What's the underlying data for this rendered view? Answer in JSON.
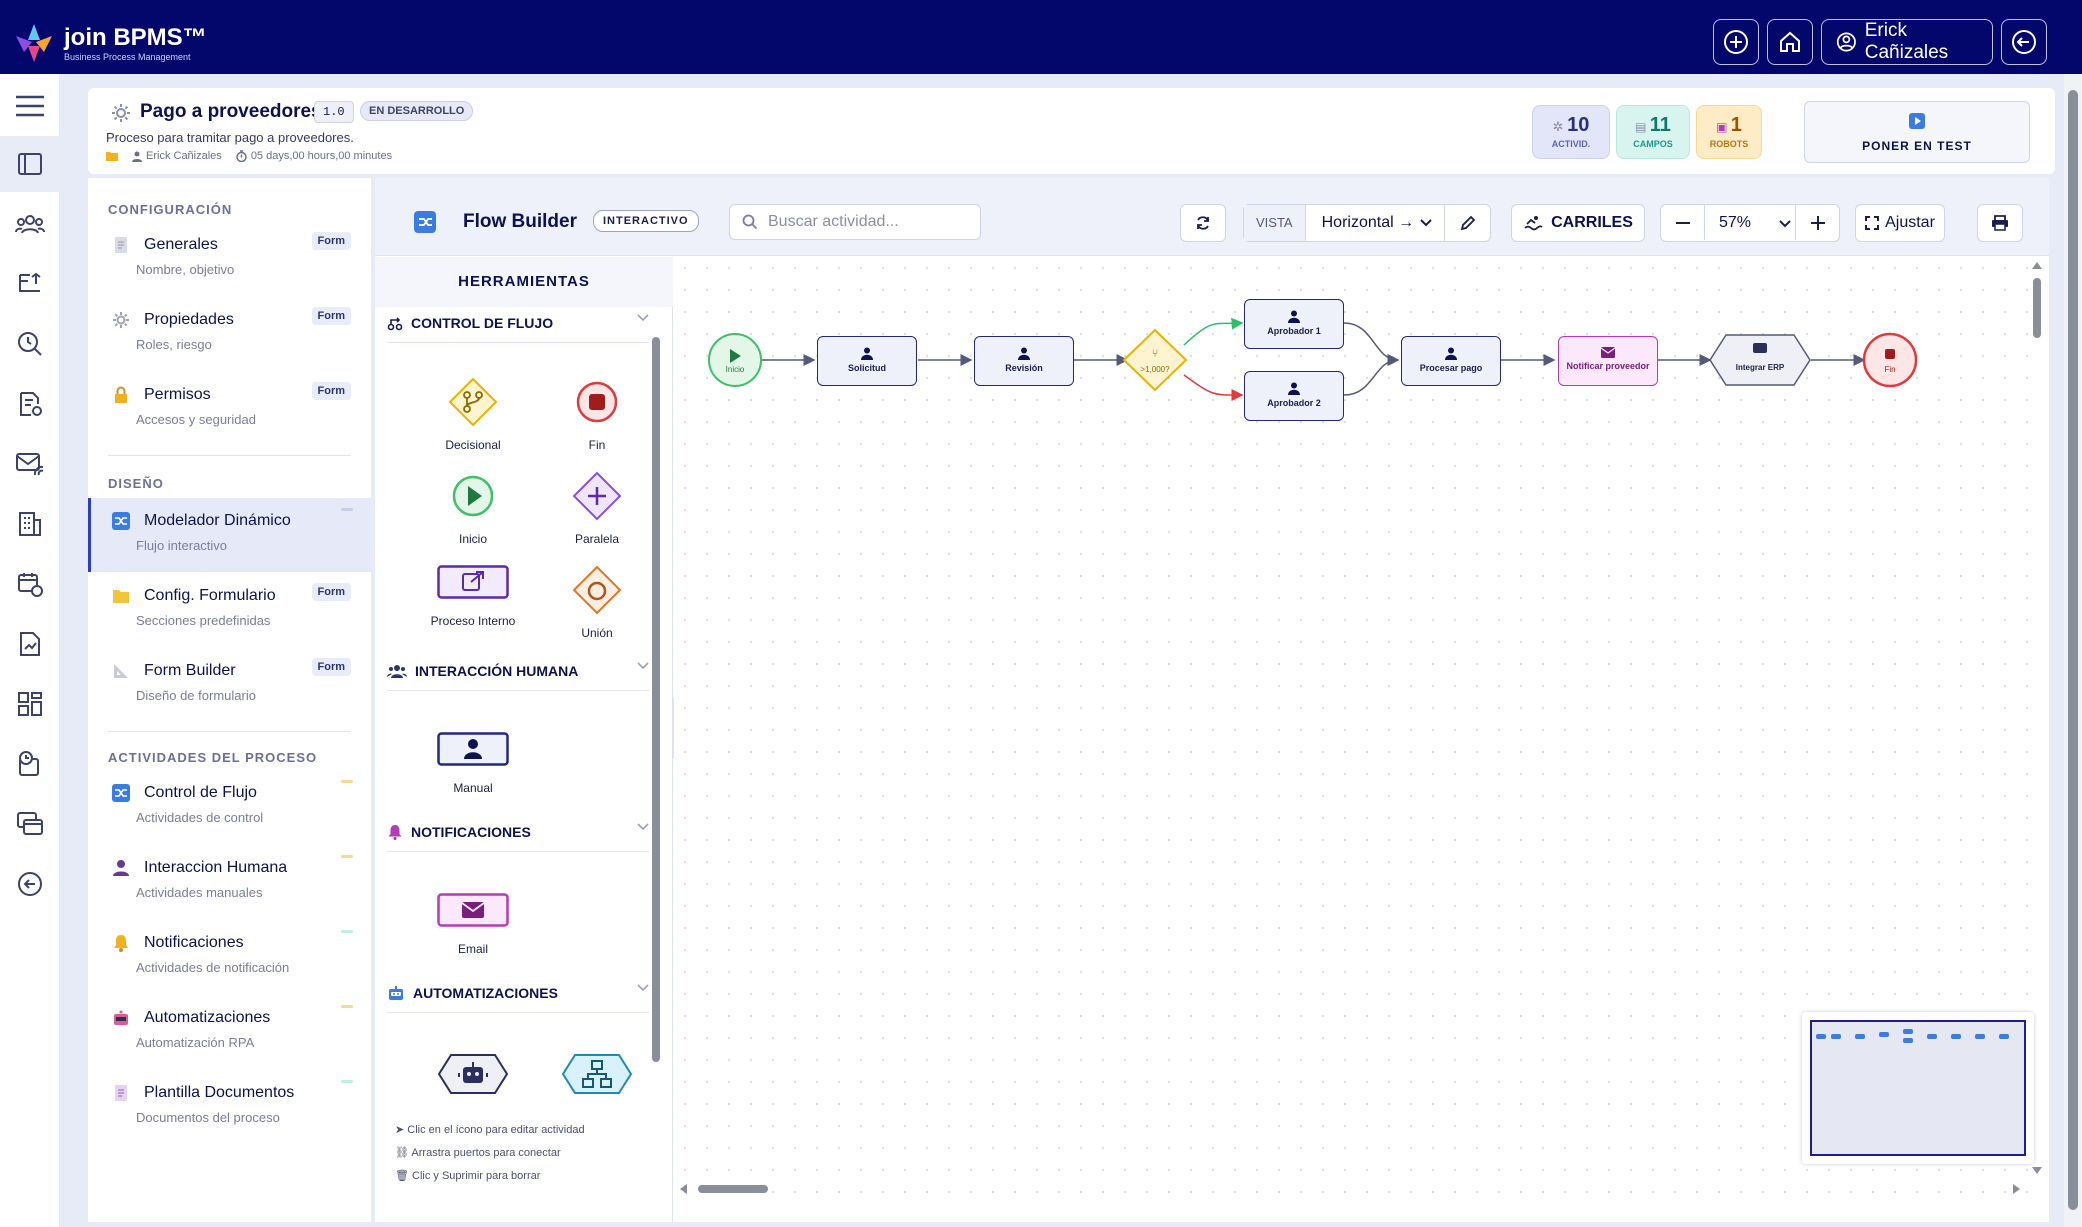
{
  "topbar": {
    "brand": "join BPMS™",
    "brand_sub": "Business Process Management",
    "user_name": "Erick Cañizales",
    "icons": [
      "plus-icon",
      "home-icon",
      "user-circle-icon",
      "logout-icon"
    ]
  },
  "rail": {
    "icons": [
      "menu-icon",
      "panels-icon",
      "users-icon",
      "flow-list-icon",
      "search-clock-icon",
      "doc-settings-icon",
      "mail-chart-icon",
      "building-icon",
      "calendar-check-icon",
      "file-chart-icon",
      "dashboard-icon",
      "calendar-clock-icon",
      "layers-icon",
      "back-circle-icon"
    ]
  },
  "process": {
    "title": "Pago a proveedores",
    "version": "1.0",
    "status": "EN DESARROLLO",
    "description": "Proceso para tramitar pago a proveedores.",
    "owner": "Erick Cañizales",
    "duration": "05 days,00 hours,00 minutes",
    "stats": [
      {
        "value": "10",
        "label": "ACTIVID.",
        "color": "#26307e",
        "bg": "#e3e6f8"
      },
      {
        "value": "11",
        "label": "CAMPOS",
        "color": "#0f7a6a",
        "bg": "#d8f4ef"
      },
      {
        "value": "1",
        "label": "ROBOTS",
        "color": "#9c5300",
        "bg": "#fdecc6"
      }
    ],
    "test_button": "PONER EN TEST"
  },
  "config": {
    "sections": [
      {
        "title": "CONFIGURACIÓN",
        "items": [
          {
            "title": "Generales",
            "sub": "Nombre, objetivo",
            "badge": "Form"
          },
          {
            "title": "Propiedades",
            "sub": "Roles, riesgo",
            "badge": "Form"
          },
          {
            "title": "Permisos",
            "sub": "Accesos y seguridad",
            "badge": "Form"
          }
        ]
      },
      {
        "title": "DISEÑO",
        "items": [
          {
            "title": "Modelador Dinámico",
            "sub": "Flujo interactivo",
            "badge": ""
          },
          {
            "title": "Config. Formulario",
            "sub": "Secciones predefinidas",
            "badge": "Form"
          },
          {
            "title": "Form Builder",
            "sub": "Diseño de formulario",
            "badge": "Form"
          }
        ]
      },
      {
        "title": "ACTIVIDADES DEL PROCESO",
        "items": [
          {
            "title": "Control de Flujo",
            "sub": "Actividades de control",
            "badge": ""
          },
          {
            "title": "Interaccion Humana",
            "sub": "Actividades manuales",
            "badge": ""
          },
          {
            "title": "Notificaciones",
            "sub": "Actividades de notificación",
            "badge": ""
          },
          {
            "title": "Automatizaciones",
            "sub": "Automatización RPA",
            "badge": ""
          },
          {
            "title": "Plantilla Documentos",
            "sub": "Documentos del proceso",
            "badge": ""
          }
        ]
      }
    ]
  },
  "flow_builder": {
    "title": "Flow Builder",
    "mode": "INTERACTIVO",
    "search_placeholder": "Buscar actividad...",
    "vista_label": "VISTA",
    "vista_value": "Horizontal →",
    "lanes_label": "CARRILES",
    "zoom": "57%",
    "fit_label": "Ajustar"
  },
  "tools": {
    "header": "HERRAMIENTAS",
    "groups": [
      {
        "title": "CONTROL DE FLUJO",
        "items": [
          "Decisional",
          "Fin",
          "Inicio",
          "Paralela",
          "Proceso Interno",
          "Unión"
        ]
      },
      {
        "title": "INTERACCIÓN HUMANA",
        "items": [
          "Manual"
        ]
      },
      {
        "title": "NOTIFICACIONES",
        "items": [
          "Email"
        ]
      },
      {
        "title": "AUTOMATIZACIONES",
        "items": [
          "",
          ""
        ]
      }
    ],
    "hints": [
      "Clic en el ícono para editar actividad",
      "Arrastra puertos para conectar",
      "Clic y Suprimir para borrar"
    ]
  },
  "diagram": {
    "nodes": [
      "Inicio",
      "Solicitud",
      "Revisión",
      ">1,000?",
      "Aprobador 1",
      "Aprobador 2",
      "Procesar pago",
      "Notificar proveedor",
      "Integrar ERP",
      "Fin"
    ]
  },
  "colors": {
    "topbar": "#03076c",
    "accent": "#2d3cc4",
    "start": "#3fbf6a",
    "end": "#e23a3a",
    "decision": "#e8b400",
    "notify": "#b63bb8"
  }
}
